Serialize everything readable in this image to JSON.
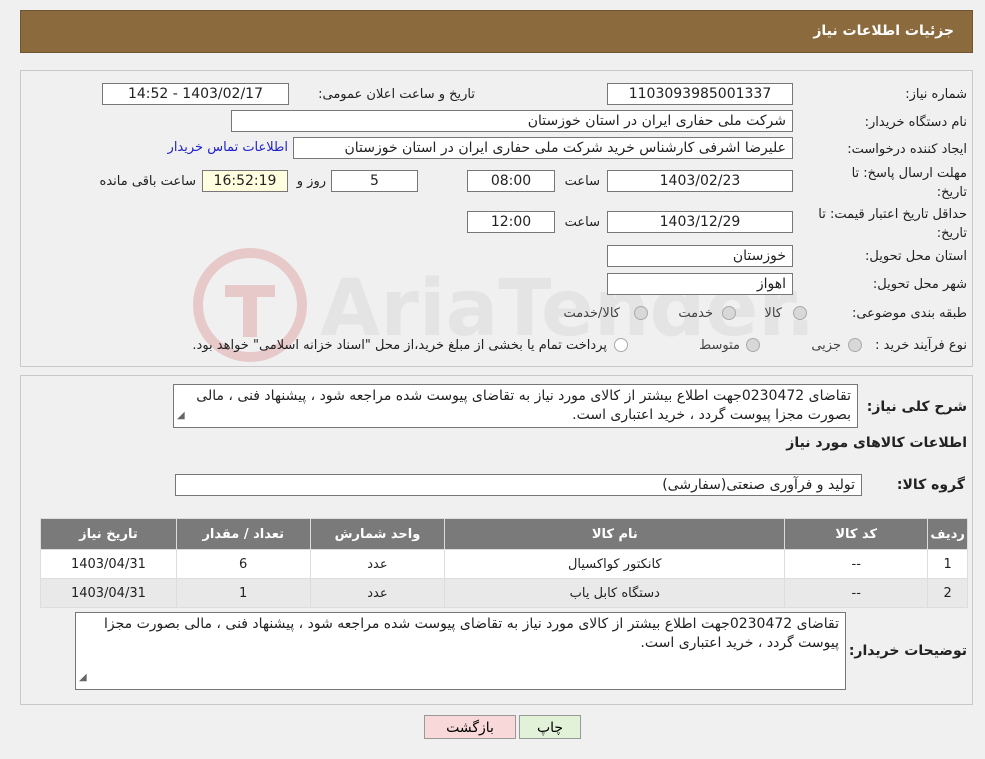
{
  "header": {
    "title": "جزئیات اطلاعات نیاز"
  },
  "form": {
    "need_number_label": "شماره نیاز:",
    "need_number": "1103093985001337",
    "announce_label": "تاریخ و ساعت اعلان عمومی:",
    "announce_value": "1403/02/17 - 14:52",
    "buyer_org_label": "نام دستگاه خریدار:",
    "buyer_org": "شرکت ملی حفاری ایران در استان خوزستان",
    "requester_label": "ایجاد کننده درخواست:",
    "requester": "علیرضا اشرفی کارشناس خرید شرکت ملی حفاری ایران در استان خوزستان",
    "contact_link": "اطلاعات تماس خریدار",
    "deadline_label_1": "مهلت ارسال پاسخ: تا",
    "deadline_label_2": "تاریخ:",
    "deadline_date": "1403/02/23",
    "time_label": "ساعت",
    "deadline_time": "08:00",
    "days_value": "5",
    "days_label": "روز و",
    "remaining_time": "16:52:19",
    "remaining_label": "ساعت باقی مانده",
    "validity_label_1": "حداقل تاریخ اعتبار قیمت: تا",
    "validity_label_2": "تاریخ:",
    "validity_date": "1403/12/29",
    "validity_time": "12:00",
    "province_label": "استان محل تحویل:",
    "province": "خوزستان",
    "city_label": "شهر محل تحویل:",
    "city": "اهواز",
    "category_label": "طبقه بندی موضوعی:",
    "category_options": [
      "کالا",
      "خدمت",
      "کالا/خدمت"
    ],
    "process_label": "نوع فرآیند خرید :",
    "process_options": [
      "جزیی",
      "متوسط"
    ],
    "process_note": "پرداخت تمام یا بخشی از مبلغ خرید،از محل \"اسناد خزانه اسلامی\" خواهد بود."
  },
  "description": {
    "label": "شرح کلی نیاز:",
    "text": "تقاضای 0230472جهت اطلاع بیشتر از کالای مورد نیاز به تقاضای پیوست شده مراجعه شود ، پیشنهاد فنی ، مالی بصورت مجزا پیوست گردد ، خرید اعتباری است."
  },
  "goods": {
    "section_title": "اطلاعات کالاهای مورد نیاز",
    "group_label": "گروه کالا:",
    "group_value": "تولید و فرآوری صنعتی(سفارشی)",
    "columns": [
      "ردیف",
      "کد کالا",
      "نام کالا",
      "واحد شمارش",
      "تعداد / مقدار",
      "تاریخ نیاز"
    ],
    "rows": [
      [
        "1",
        "--",
        "کانکتور کواکسیال",
        "عدد",
        "6",
        "1403/04/31"
      ],
      [
        "2",
        "--",
        "دستگاه کابل یاب",
        "عدد",
        "1",
        "1403/04/31"
      ]
    ]
  },
  "buyer_notes": {
    "label": "توضیحات خریدار:",
    "text": "تقاضای 0230472جهت اطلاع بیشتر از کالای مورد نیاز به تقاضای پیوست شده مراجعه شود ، پیشنهاد فنی ، مالی بصورت مجزا پیوست گردد ، خرید اعتباری است."
  },
  "buttons": {
    "print": "چاپ",
    "back": "بازگشت"
  },
  "watermark": "AriaTender.neT",
  "colors": {
    "header": "#8b6b3d",
    "table_header": "#7a7a7a",
    "link": "#2222cc",
    "back_button": "#f8d8d8",
    "print_button": "#e2f2d8"
  }
}
